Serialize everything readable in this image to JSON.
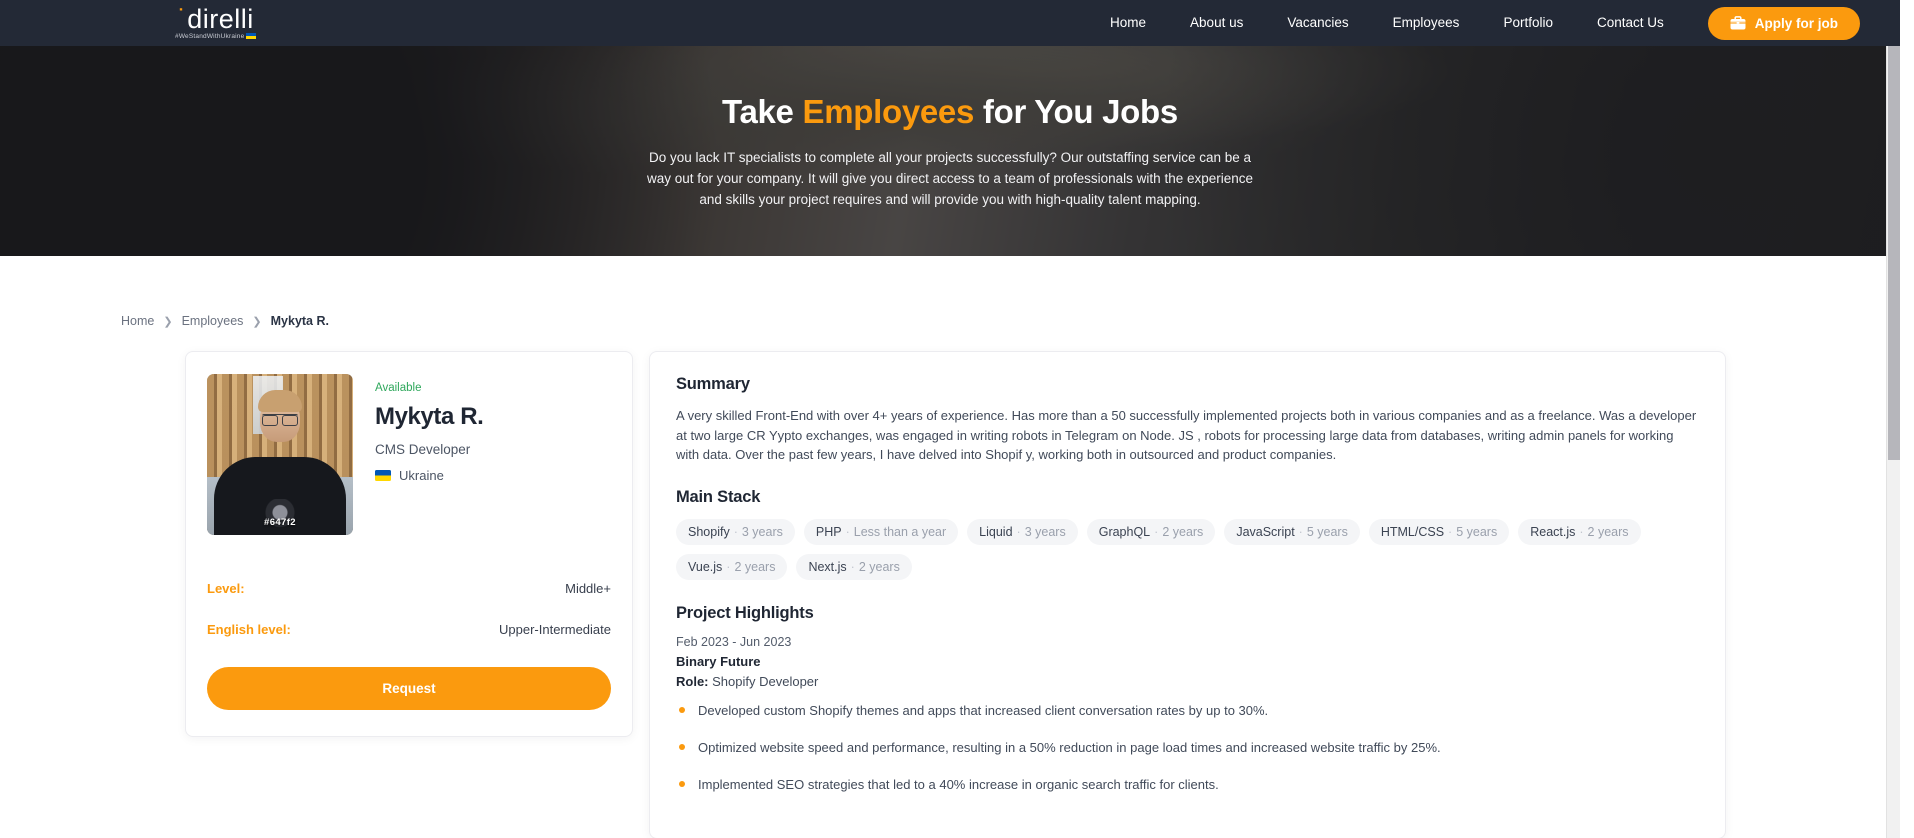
{
  "colors": {
    "accent": "#fb9a0e",
    "header_bg": "#232936",
    "available": "#2fa85c",
    "text": "#2b3445"
  },
  "header": {
    "logo_word": "direlli",
    "logo_tagline": "#WeStandWithUkraine",
    "nav": [
      {
        "label": "Home"
      },
      {
        "label": "About us"
      },
      {
        "label": "Vacancies"
      },
      {
        "label": "Employees"
      },
      {
        "label": "Portfolio"
      },
      {
        "label": "Contact Us"
      }
    ],
    "apply_button": "Apply for job",
    "apply_icon": "briefcase-icon"
  },
  "hero": {
    "title_pre": "Take ",
    "title_highlight": "Employees",
    "title_post": " for You Jobs",
    "subtitle": "Do you lack IT specialists to complete all your projects successfully? Our outstaffing service can be a way out for your company. It will give you direct access to a team of professionals with the experience and skills your project requires and will provide you with high-quality talent mapping."
  },
  "breadcrumb": [
    {
      "label": "Home",
      "active": false
    },
    {
      "label": "Employees",
      "active": false
    },
    {
      "label": "Mykyta R.",
      "active": true
    }
  ],
  "profile": {
    "status": "Available",
    "name": "Mykyta R.",
    "role": "CMS Developer",
    "country": "Ukraine",
    "photo_id": "#647f2",
    "attributes": [
      {
        "label": "Level:",
        "value": "Middle+"
      },
      {
        "label": "English level:",
        "value": "Upper-Intermediate"
      }
    ],
    "request_button": "Request"
  },
  "details": {
    "summary_title": "Summary",
    "summary_text": "A very skilled Front-End with over 4+ years of experience. Has more than a 50 successfully implemented projects both in various companies and as a freelance. Was a developer at two large CR Yypto exchanges, was engaged in writing robots in Telegram on Node. JS , robots for processing large data from databases, writing admin panels for working with data. Over the past few years, I have delved into Shopif y, working both in outsourced and product companies.",
    "stack_title": "Main Stack",
    "stack": [
      {
        "name": "Shopify",
        "years": "3 years"
      },
      {
        "name": "PHP",
        "years": "Less than a year"
      },
      {
        "name": "Liquid",
        "years": "3 years"
      },
      {
        "name": "GraphQL",
        "years": "2 years"
      },
      {
        "name": "JavaScript",
        "years": "5 years"
      },
      {
        "name": "HTML/CSS",
        "years": "5 years"
      },
      {
        "name": "React.js",
        "years": "2 years"
      },
      {
        "name": "Vue.js",
        "years": "2 years"
      },
      {
        "name": "Next.js",
        "years": "2 years"
      }
    ],
    "highlights_title": "Project Highlights",
    "project": {
      "dates": "Feb 2023 - Jun 2023",
      "name": "Binary Future",
      "role_label": "Role:",
      "role_value": "Shopify Developer",
      "bullets": [
        "Developed custom Shopify themes and apps that increased client conversation rates by up to 30%.",
        "Optimized website speed and performance, resulting in a 50% reduction in page load times and increased website traffic by 25%.",
        "Implemented SEO strategies that led to a 40% increase in organic search traffic for clients."
      ]
    }
  }
}
